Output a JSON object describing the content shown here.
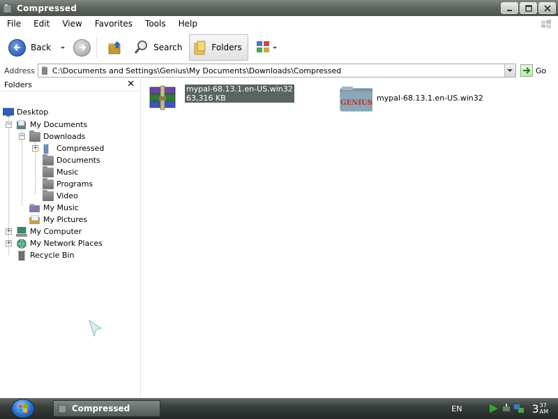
{
  "window": {
    "title": "Compressed"
  },
  "menu": [
    "File",
    "Edit",
    "View",
    "Favorites",
    "Tools",
    "Help"
  ],
  "toolbar": {
    "back_label": "Back",
    "search_label": "Search",
    "folders_label": "Folders"
  },
  "address": {
    "label": "Address",
    "path": "C:\\Documents and Settings\\Genius\\My Documents\\Downloads\\Compressed",
    "go_label": "Go"
  },
  "folder_pane": {
    "title": "Folders",
    "tree": {
      "desktop": "Desktop",
      "my_documents": "My Documents",
      "downloads": "Downloads",
      "compressed": "Compressed",
      "documents": "Documents",
      "music": "Music",
      "programs": "Programs",
      "video": "Video",
      "my_music": "My Music",
      "my_pictures": "My Pictures",
      "my_computer": "My Computer",
      "my_network_places": "My Network Places",
      "recycle_bin": "Recycle Bin"
    }
  },
  "files": [
    {
      "name": "mypal-68.13.1.en-US.win32",
      "size": "63,316 KB",
      "icon": "winrar-archive-icon",
      "selected": true
    },
    {
      "name": "mypal-68.13.1.en-US.win32",
      "icon": "genius-folder-icon",
      "icon_text": "GENIUS",
      "selected": false
    }
  ],
  "taskbar": {
    "task_label": "Compressed",
    "language": "EN",
    "clock_hour": "3",
    "clock_minute": "37",
    "clock_ampm": "AM"
  }
}
